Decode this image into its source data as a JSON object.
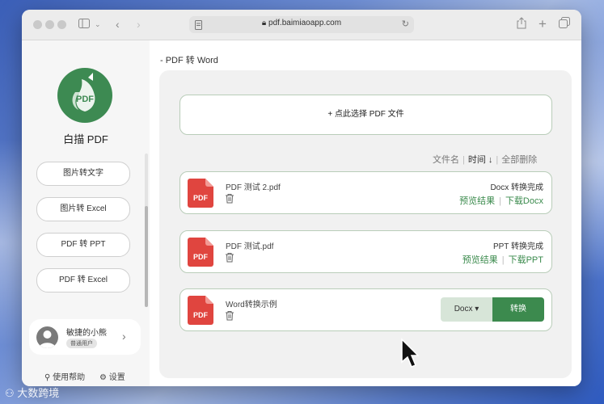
{
  "browser": {
    "url": "pdf.baimiaoapp.com"
  },
  "sidebar": {
    "app_name": "白描 PDF",
    "logo_text": "PDF",
    "nav": [
      {
        "label": "图片转文字"
      },
      {
        "label": "图片转 Excel"
      },
      {
        "label": "PDF 转 PPT"
      },
      {
        "label": "PDF 转 Excel"
      }
    ],
    "user": {
      "name": "敏捷的小熊",
      "badge": "普通用户"
    },
    "help_label": "使用帮助",
    "settings_label": "设置"
  },
  "main": {
    "breadcrumb": "- PDF 转 Word",
    "upload_label": "+ 点此选择 PDF 文件",
    "sort": {
      "by_name": "文件名",
      "by_time": "时间 ↓",
      "delete_all": "全部删除"
    },
    "files": [
      {
        "name": "PDF 测试 2.pdf",
        "status": "Docx 转换完成",
        "preview": "预览结果",
        "download": "下载Docx"
      },
      {
        "name": "PDF 测试.pdf",
        "status": "PPT 转换完成",
        "preview": "预览结果",
        "download": "下载PPT"
      },
      {
        "name": "Word转换示例",
        "format": "Docx",
        "convert": "转换"
      }
    ],
    "pdf_icon_label": "PDF"
  },
  "watermark": "大数跨境",
  "colors": {
    "accent": "#3c8a4e",
    "pdf_red": "#e0453f",
    "card_border": "#b9cdb9"
  }
}
